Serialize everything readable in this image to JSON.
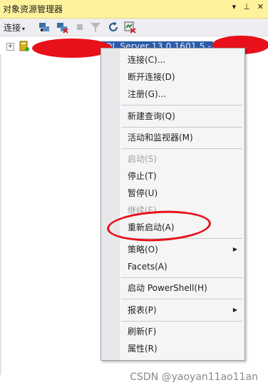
{
  "window": {
    "title": "对象资源管理器",
    "pin_label": "▾ ⊥ ✕"
  },
  "toolbar": {
    "connect_label": "连接",
    "icons": [
      "connect-object-icon",
      "disconnect-icon",
      "stop-icon",
      "filter-icon",
      "refresh-icon",
      "activity-icon"
    ]
  },
  "tree": {
    "server_label": "SQL Server 13.0.1601.5 -",
    "expander": "+"
  },
  "context_menu": {
    "items": [
      {
        "label": "连接(C)...",
        "enabled": true
      },
      {
        "label": "断开连接(D)",
        "enabled": true
      },
      {
        "label": "注册(G)...",
        "enabled": true
      },
      {
        "label": "新建查询(Q)",
        "enabled": true
      },
      {
        "label": "活动和监视器(M)",
        "enabled": true
      },
      {
        "label": "启动(S)",
        "enabled": false
      },
      {
        "label": "停止(T)",
        "enabled": true
      },
      {
        "label": "暂停(U)",
        "enabled": true
      },
      {
        "label": "继续(E)",
        "enabled": false
      },
      {
        "label": "重新启动(A)",
        "enabled": true
      },
      {
        "label": "策略(O)",
        "enabled": true,
        "submenu": true
      },
      {
        "label": "Facets(A)",
        "enabled": true
      },
      {
        "label": "启动 PowerShell(H)",
        "enabled": true
      },
      {
        "label": "报表(P)",
        "enabled": true,
        "submenu": true
      },
      {
        "label": "刷新(F)",
        "enabled": true
      },
      {
        "label": "属性(R)",
        "enabled": true
      }
    ]
  },
  "watermark": "CSDN @yaoyan11ao11an",
  "colors": {
    "titlebar": "#fff29d",
    "redaction": "#e8101a",
    "menu_background": "#f5f5f5"
  }
}
